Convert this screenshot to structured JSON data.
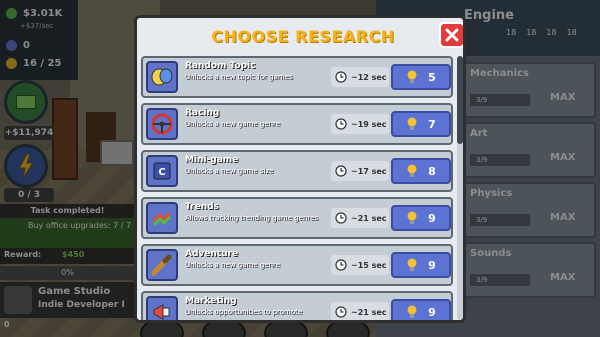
{
  "hud": {
    "money": "$3.01K",
    "money_rate": "+$37/sec",
    "fans": "0",
    "research_points": "16 / 25",
    "cash_button": "+$11,974",
    "energy_counter": "0 / 3",
    "colors": {
      "money": "#5bc24b",
      "fans": "#6b7fe3",
      "research": "#f5c033"
    }
  },
  "task": {
    "title": "Task completed!",
    "line": "Buy office upgrades: 7 / 7",
    "reward_label": "Reward:",
    "reward_value": "$450",
    "progress": "0%"
  },
  "studio": {
    "name": "Game Studio",
    "rank": "Indie Developer I",
    "count": "0"
  },
  "engine_panel": {
    "title": "Engine",
    "stats": [
      "18",
      "18",
      "18",
      "18"
    ],
    "items": [
      {
        "name": "Mechanics",
        "progress": "3/9",
        "status": "MAX"
      },
      {
        "name": "Art",
        "progress": "3/9",
        "status": "MAX"
      },
      {
        "name": "Physics",
        "progress": "3/9",
        "status": "MAX"
      },
      {
        "name": "Sounds",
        "progress": "3/9",
        "status": "MAX"
      }
    ]
  },
  "modal": {
    "title": "CHOOSE RESEARCH",
    "items": [
      {
        "name": "Random Topic",
        "desc": "Unlocks a new topic for games",
        "time": "~12 sec",
        "cost": "5",
        "icon": "masks-icon"
      },
      {
        "name": "Racing",
        "desc": "Unlocks a new game genre",
        "time": "~19 sec",
        "cost": "7",
        "icon": "steering-wheel-icon"
      },
      {
        "name": "Mini-game",
        "desc": "Unlocks a new game size",
        "time": "~17 sec",
        "cost": "8",
        "icon": "cube-c-icon"
      },
      {
        "name": "Trends",
        "desc": "Allows tracking trending game genres",
        "time": "~21 sec",
        "cost": "9",
        "icon": "trend-arrows-icon"
      },
      {
        "name": "Adventure",
        "desc": "Unlocks a new game genre",
        "time": "~15 sec",
        "cost": "9",
        "icon": "telescope-icon"
      },
      {
        "name": "Marketing",
        "desc": "Unlocks opportunities to promote",
        "time": "~21 sec",
        "cost": "9",
        "icon": "megaphone-icon"
      }
    ]
  }
}
